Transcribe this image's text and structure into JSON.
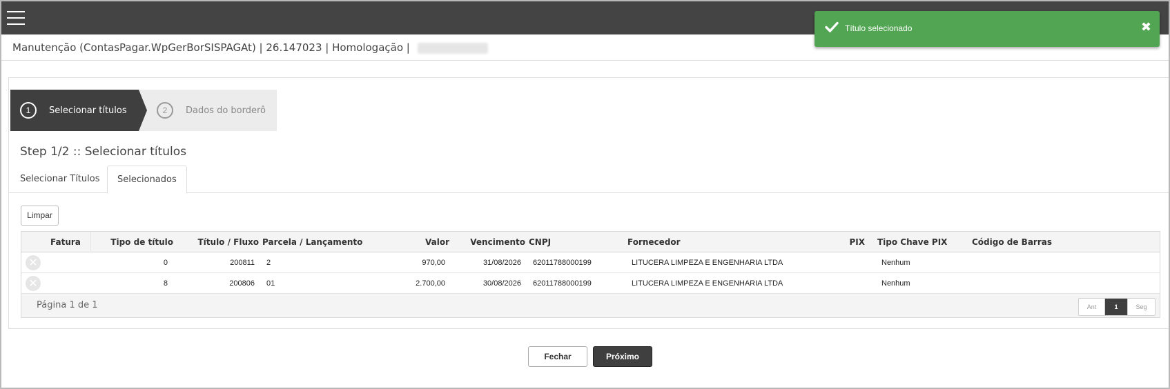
{
  "header": {
    "text": "Manutenção (ContasPagar.WpGerBorSISPAGAt) | 26.147023 | Homologação | "
  },
  "toast": {
    "message": "Título selecionado",
    "close_glyph": "✖",
    "color": "#52a552"
  },
  "wizard": {
    "steps": [
      {
        "number": "1",
        "label": "Selecionar títulos"
      },
      {
        "number": "2",
        "label": "Dados do borderô"
      }
    ],
    "title": "Step 1/2 :: Selecionar títulos"
  },
  "tabs": [
    {
      "label": "Selecionar Títulos"
    },
    {
      "label": "Selecionados"
    }
  ],
  "buttons": {
    "clear": "Limpar",
    "close": "Fechar",
    "next": "Próximo"
  },
  "table": {
    "columns": {
      "fatura": "Fatura",
      "tipo": "Tipo de título",
      "titulo": "Título / Fluxo",
      "parcela": "Parcela / Lançamento",
      "valor": "Valor",
      "vencimento": "Vencimento",
      "cnpj": "CNPJ",
      "fornecedor": "Fornecedor",
      "pix": "PIX",
      "tipo_chave_pix": "Tipo Chave PIX",
      "codigo_barras": "Código de Barras"
    },
    "rows": [
      {
        "fatura": "",
        "tipo": "0",
        "titulo": "200811",
        "parcela": "2",
        "valor": "970,00",
        "vencimento": "31/08/2026",
        "cnpj": "62011788000199",
        "fornecedor": "LITUCERA LIMPEZA E ENGENHARIA LTDA",
        "pix": "",
        "tipo_chave_pix": "Nenhum",
        "codigo_barras": ""
      },
      {
        "fatura": "",
        "tipo": "8",
        "titulo": "200806",
        "parcela": "01",
        "valor": "2.700,00",
        "vencimento": "30/08/2026",
        "cnpj": "62011788000199",
        "fornecedor": "LITUCERA LIMPEZA E ENGENHARIA LTDA",
        "pix": "",
        "tipo_chave_pix": "Nenhum",
        "codigo_barras": ""
      }
    ],
    "page_info": "Página 1 de 1",
    "pager": {
      "prev": "Ant",
      "current": "1",
      "next": "Seg"
    }
  }
}
